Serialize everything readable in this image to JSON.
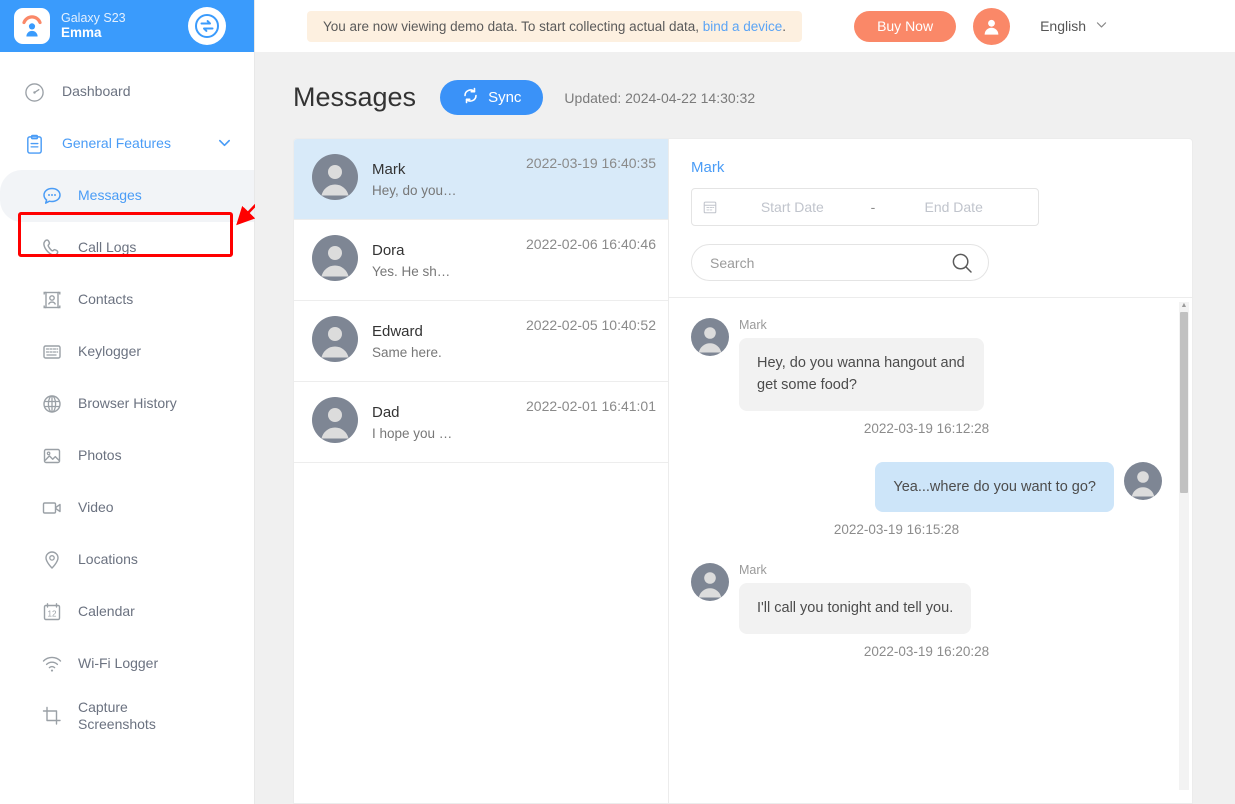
{
  "sidebar": {
    "device": {
      "model": "Galaxy S23",
      "user": "Emma"
    },
    "logo_icon": "monitor-kid-logo-icon",
    "swap_icon": "transfer-swap-icon",
    "items": [
      {
        "label": "Dashboard",
        "icon": "dashboard-gauge-icon",
        "type": "top"
      },
      {
        "label": "General Features",
        "icon": "clipboard-icon",
        "type": "group",
        "chevron": "chevron-down-icon"
      },
      {
        "label": "Messages",
        "icon": "message-bubble-icon",
        "type": "sub",
        "active": true
      },
      {
        "label": "Call Logs",
        "icon": "phone-icon",
        "type": "sub"
      },
      {
        "label": "Contacts",
        "icon": "contact-card-icon",
        "type": "sub"
      },
      {
        "label": "Keylogger",
        "icon": "keyboard-icon",
        "type": "sub"
      },
      {
        "label": "Browser History",
        "icon": "globe-icon",
        "type": "sub"
      },
      {
        "label": "Photos",
        "icon": "image-icon",
        "type": "sub"
      },
      {
        "label": "Video",
        "icon": "video-camera-icon",
        "type": "sub"
      },
      {
        "label": "Locations",
        "icon": "location-pin-icon",
        "type": "sub"
      },
      {
        "label": "Calendar",
        "icon": "calendar-icon",
        "type": "sub"
      },
      {
        "label": "Wi-Fi Logger",
        "icon": "wifi-icon",
        "type": "sub"
      },
      {
        "label": "Capture\nScreenshots",
        "icon": "crop-frame-icon",
        "type": "sub"
      }
    ]
  },
  "topbar": {
    "demo_text": "You are now viewing demo data. To start collecting actual data, ",
    "demo_link": "bind a device",
    "demo_text_end": ".",
    "buy_label": "Buy Now",
    "account_icon": "user-avatar-icon",
    "language": "English",
    "language_chevron": "chevron-down-icon"
  },
  "page": {
    "title": "Messages",
    "sync_label": "Sync",
    "sync_icon": "refresh-sync-icon",
    "updated": "Updated: 2024-04-22 14:30:32"
  },
  "conversations": [
    {
      "name": "Mark",
      "snippet": "Hey, do you…",
      "time": "2022-03-19 16:40:35",
      "selected": true
    },
    {
      "name": "Dora",
      "snippet": "Yes. He sh…",
      "time": "2022-02-06 16:40:46",
      "selected": false
    },
    {
      "name": "Edward",
      "snippet": "Same here.",
      "time": "2022-02-05 10:40:52",
      "selected": false
    },
    {
      "name": "Dad",
      "snippet": "I hope you …",
      "time": "2022-02-01 16:41:01",
      "selected": false
    }
  ],
  "chat": {
    "title": "Mark",
    "calendar_icon": "calendar-icon",
    "start_date_placeholder": "Start Date",
    "range_dash": "-",
    "end_date_placeholder": "End Date",
    "search_placeholder": "Search",
    "search_value": "",
    "search_icon": "search-icon",
    "messages": [
      {
        "sender": "Mark",
        "text": "Hey, do you wanna hangout and get some food?",
        "time": "2022-03-19 16:12:28",
        "direction": "in"
      },
      {
        "sender": "",
        "text": "Yea...where do you want to go?",
        "time": "2022-03-19 16:15:28",
        "direction": "out"
      },
      {
        "sender": "Mark",
        "text": "I'll call you tonight and tell you.",
        "time": "2022-03-19 16:20:28",
        "direction": "in"
      }
    ]
  },
  "annotation": {
    "highlight_target": "Messages",
    "arrow": "red-pointer-arrow"
  },
  "colors": {
    "brand_blue": "#3a9bfc",
    "accent_orange": "#fa8868",
    "selected_row": "#d8eaf9",
    "out_bubble": "#cde5f9",
    "in_bubble": "#f2f2f2",
    "annotation_red": "#ff0000"
  }
}
